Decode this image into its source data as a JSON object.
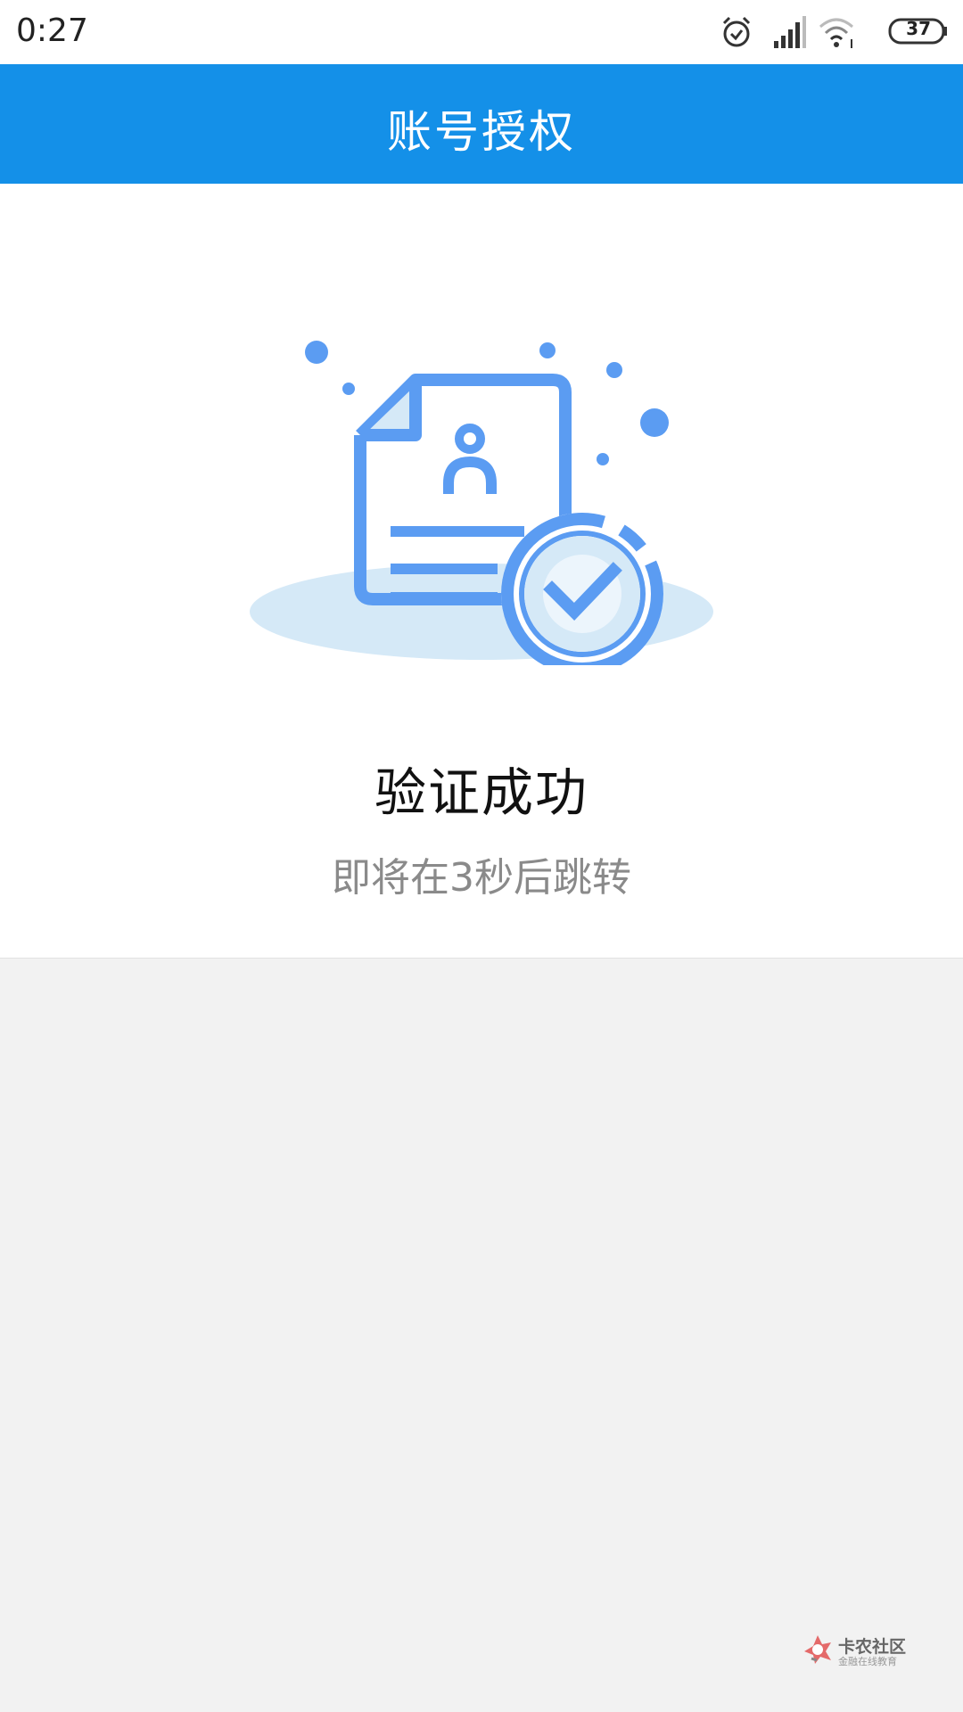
{
  "status_bar": {
    "time": "0:27",
    "battery": "37",
    "icons": [
      "alarm-icon",
      "signal-icon",
      "wifi-icon",
      "battery-icon"
    ]
  },
  "header": {
    "title": "账号授权"
  },
  "result": {
    "title": "验证成功",
    "subtitle": "即将在3秒后跳转",
    "illustration_icon": "verified-document-icon"
  },
  "watermark": {
    "name": "卡农社区",
    "slogan": "金融在线教育"
  },
  "colors": {
    "header_bg": "#1490e8",
    "illustration_blue": "#5b9cf2",
    "illustration_light": "#d5e9f7",
    "page_bg": "#f2f2f2"
  }
}
